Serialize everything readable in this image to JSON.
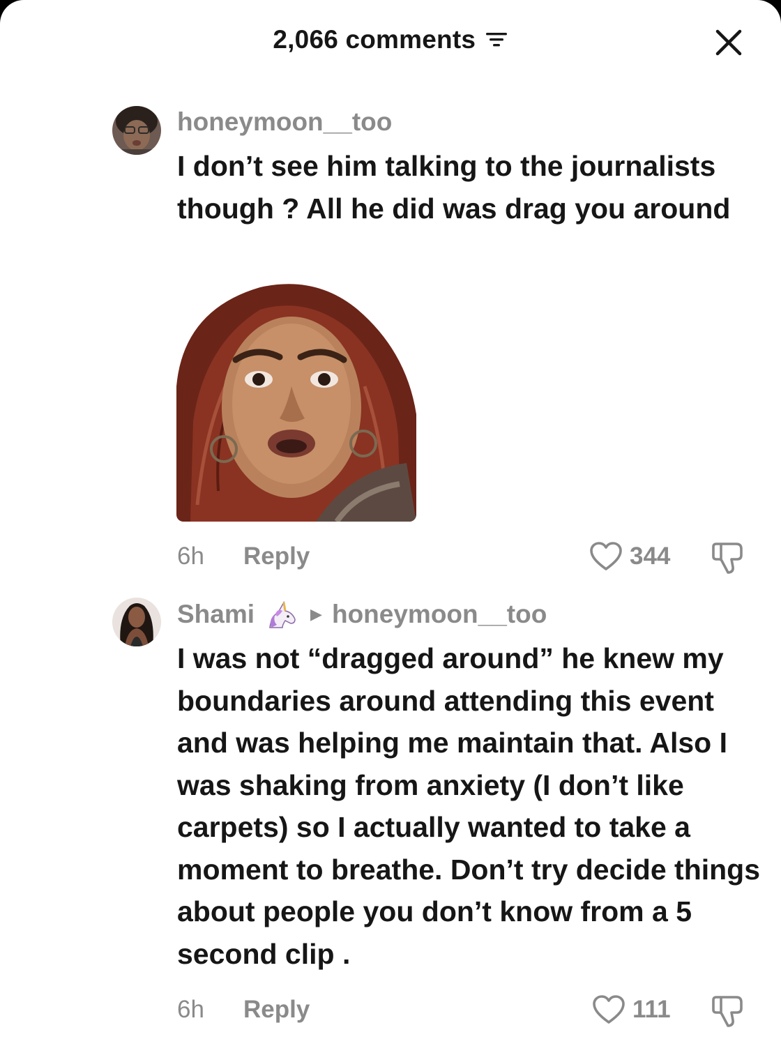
{
  "header": {
    "title": "2,066 comments",
    "sort_icon": "sort-filter-icon",
    "close_icon": "close-icon"
  },
  "comments": [
    {
      "username": "honeymoon__too",
      "text": "I don’t see him talking to the journalists though ? All he did was drag you around",
      "time": "6h",
      "reply_label": "Reply",
      "likes": "344",
      "has_sticker": true
    },
    {
      "username": "Shami",
      "username_emoji": "unicorn",
      "reply_to": "honeymoon__too",
      "text": "I was not “dragged around” he knew my boundaries around attending this event and was helping me maintain that. Also I was shaking from anxiety (I don’t like carpets) so I actually wanted to take a moment to breathe. Don’t try decide things about people you don’t know from a 5 second clip .",
      "time": "6h",
      "reply_label": "Reply",
      "likes": "111"
    }
  ],
  "colors": {
    "primary_text": "#161616",
    "secondary_text": "#8a8a8a",
    "background": "#ffffff"
  }
}
